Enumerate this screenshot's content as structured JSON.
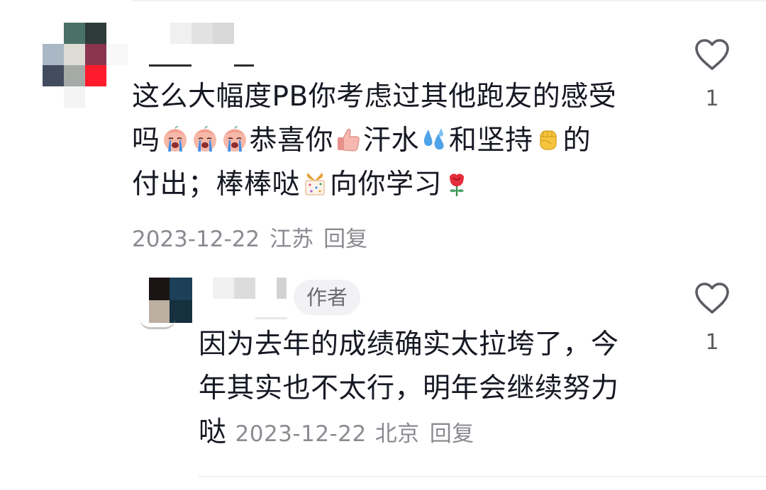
{
  "comments": [
    {
      "lines": [
        {
          "segments": [
            "这么大幅度PB你考虑过其他跑友的感受"
          ]
        },
        {
          "segments": [
            "吗",
            "{cry}",
            "{cry}",
            "{cry}",
            "恭喜你",
            "{thumb}",
            "汗水",
            "{sweat}",
            "和坚持",
            "{fist}",
            "的"
          ]
        },
        {
          "segments": [
            "付出；棒棒哒",
            "{gift}",
            "向你学习",
            "{rose}"
          ]
        }
      ],
      "date": "2023-12-22",
      "location": "江苏",
      "reply_label": "回复",
      "likes": "1",
      "avatar_colors": [
        [
          "#ffffff",
          "#4a7068",
          "#2e3b39",
          "#ffffff"
        ],
        [
          "#aab7c4",
          "#dedbd5",
          "#8a3550",
          "#f8f8f8"
        ],
        [
          "#434c5f",
          "#a4aba7",
          "#ff1b2c",
          "#ffffff"
        ],
        [
          "#ffffff",
          "#f4f4f4",
          "#ffffff",
          "#ffffff"
        ]
      ]
    },
    {
      "author_badge": "作者",
      "lines": [
        {
          "segments": [
            "因为去年的成绩确实太拉垮了，今"
          ]
        },
        {
          "segments": [
            "年其实也不太行，明年会继续努力"
          ]
        },
        {
          "segments": [
            "哒"
          ]
        }
      ],
      "date": "2023-12-22",
      "location": "北京",
      "reply_label": "回复",
      "likes": "1",
      "avatar_colors": [
        "#1a1514",
        "#1b4057",
        "#bdaea2",
        "#15303f"
      ]
    }
  ],
  "icons": {
    "like": "heart-outline-icon",
    "cry": "crying-face-emoji",
    "thumb": "thumbs-up-emoji",
    "sweat": "sweat-droplets-emoji",
    "fist": "raised-fist-emoji",
    "gift": "wrapped-gift-emoji",
    "rose": "rose-emoji"
  }
}
